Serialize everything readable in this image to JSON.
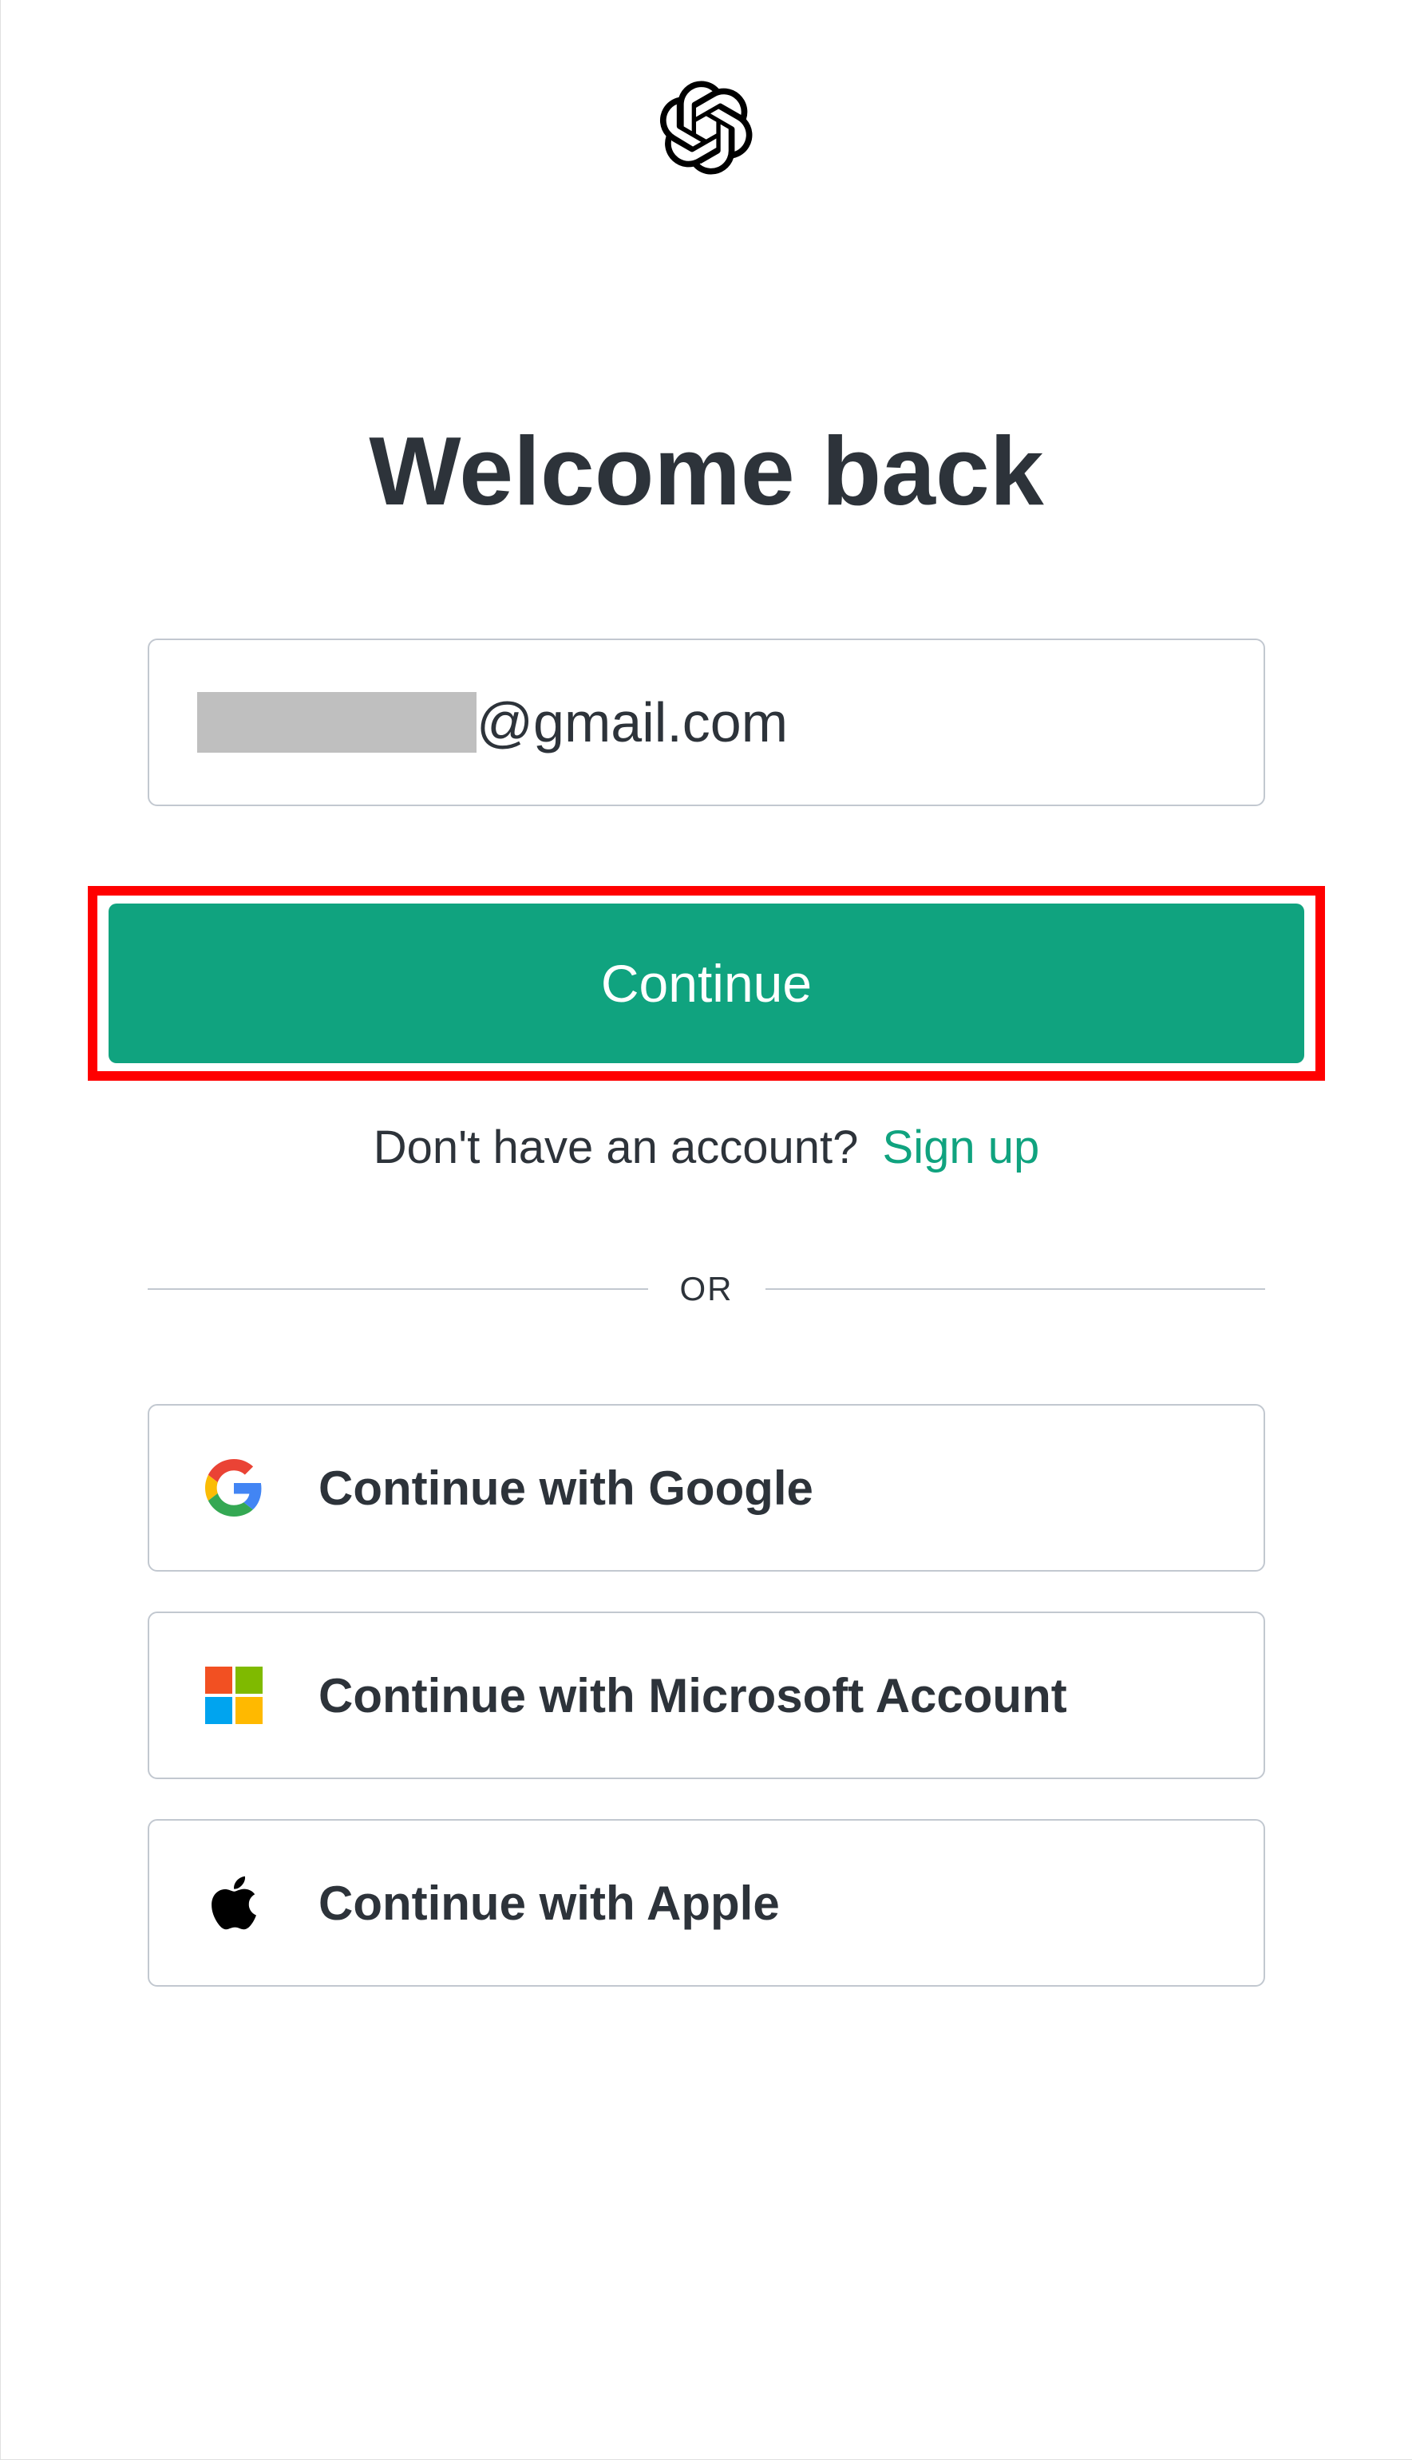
{
  "header": {
    "title": "Welcome back"
  },
  "form": {
    "email_visible_part": "@gmail.com",
    "continue_label": "Continue"
  },
  "signup": {
    "prompt": "Don't have an account?",
    "link_label": "Sign up"
  },
  "divider": {
    "label": "OR"
  },
  "social": {
    "google_label": "Continue with Google",
    "microsoft_label": "Continue with Microsoft Account",
    "apple_label": "Continue with Apple"
  },
  "colors": {
    "accent": "#10a37f",
    "highlight_border": "#ff0000",
    "text": "#2d333a",
    "border": "#c2c8d0"
  }
}
